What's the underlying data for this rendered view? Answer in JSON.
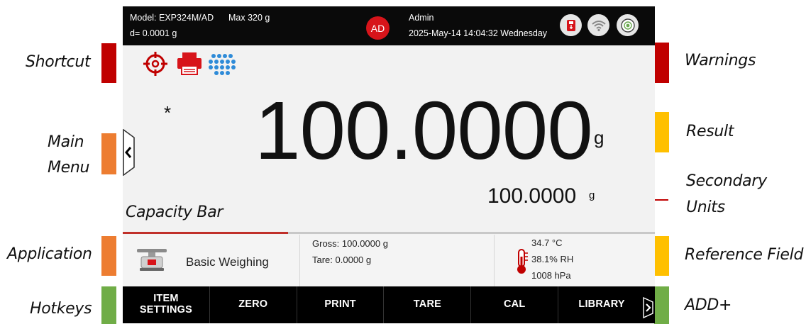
{
  "callouts": {
    "shortcut": "Shortcut",
    "main_menu_line1": "Main",
    "main_menu_line2": "Menu",
    "application": "Application",
    "hotkeys": "Hotkeys",
    "warnings": "Warnings",
    "result": "Result",
    "secondary_units_line1": "Secondary",
    "secondary_units_line2": "Units",
    "reference_field": "Reference Field",
    "add_plus": "ADD+",
    "capacity_bar": "Capacity Bar"
  },
  "topbar": {
    "model": "Model: EXP324M/AD",
    "max": "Max 320 g",
    "readability": "d= 0.0001 g",
    "user_badge": "AD",
    "user_name": "Admin",
    "datetime": "2025-May-14 14:04:32 Wednesday"
  },
  "icons": {
    "shortcut": [
      "level-target-icon",
      "printer-icon",
      "keypad-dots-icon"
    ],
    "status": [
      "usb-icon",
      "wifi-icon",
      "level-bubble-icon"
    ],
    "menu_tab": "chevron-left-icon",
    "application": "scale-icon",
    "reference": "thermometer-icon",
    "add": "chevron-right-icon"
  },
  "colors": {
    "accent_red": "#c00000",
    "badge_red": "#d7141a",
    "keypad_blue": "#2e8bd8",
    "callout_orange": "#ed7d31",
    "callout_yellow": "#ffc000",
    "callout_green": "#70ad47"
  },
  "result": {
    "stability_mark": "*",
    "value": "100.0000",
    "unit": "g",
    "secondary_value": "100.0000",
    "secondary_unit": "g"
  },
  "capacity": {
    "fraction": 0.31
  },
  "info": {
    "application_name": "Basic Weighing",
    "gross": "Gross: 100.0000 g",
    "tare": "Tare: 0.0000 g",
    "temperature": "34.7 °C",
    "humidity": "38.1% RH",
    "pressure": "1008 hPa"
  },
  "hotkeys": [
    {
      "label": "ITEM\nSETTINGS"
    },
    {
      "label": "ZERO"
    },
    {
      "label": "PRINT"
    },
    {
      "label": "TARE"
    },
    {
      "label": "CAL"
    },
    {
      "label": "LIBRARY"
    }
  ]
}
